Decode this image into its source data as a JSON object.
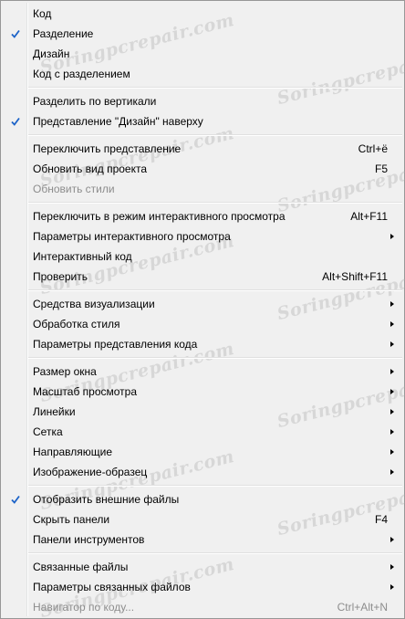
{
  "menu": {
    "watermark": "Soringpcrepair.com",
    "items": [
      {
        "label": "Код",
        "checked": false,
        "shortcut": "",
        "submenu": false,
        "disabled": false
      },
      {
        "label": "Разделение",
        "checked": true,
        "shortcut": "",
        "submenu": false,
        "disabled": false
      },
      {
        "label": "Дизайн",
        "checked": false,
        "shortcut": "",
        "submenu": false,
        "disabled": false
      },
      {
        "label": "Код с разделением",
        "checked": false,
        "shortcut": "",
        "submenu": false,
        "disabled": false
      },
      {
        "label": "Разделить по вертикали",
        "checked": false,
        "shortcut": "",
        "submenu": false,
        "disabled": false
      },
      {
        "label": "Представление \"Дизайн\" наверху",
        "checked": true,
        "shortcut": "",
        "submenu": false,
        "disabled": false
      },
      {
        "label": "Переключить представление",
        "checked": false,
        "shortcut": "Ctrl+ё",
        "submenu": false,
        "disabled": false
      },
      {
        "label": "Обновить вид проекта",
        "checked": false,
        "shortcut": "F5",
        "submenu": false,
        "disabled": false
      },
      {
        "label": "Обновить стили",
        "checked": false,
        "shortcut": "",
        "submenu": false,
        "disabled": true
      },
      {
        "label": "Переключить в режим интерактивного просмотра",
        "checked": false,
        "shortcut": "Alt+F11",
        "submenu": false,
        "disabled": false
      },
      {
        "label": "Параметры интерактивного просмотра",
        "checked": false,
        "shortcut": "",
        "submenu": true,
        "disabled": false
      },
      {
        "label": "Интерактивный код",
        "checked": false,
        "shortcut": "",
        "submenu": false,
        "disabled": false
      },
      {
        "label": "Проверить",
        "checked": false,
        "shortcut": "Alt+Shift+F11",
        "submenu": false,
        "disabled": false
      },
      {
        "label": "Средства визуализации",
        "checked": false,
        "shortcut": "",
        "submenu": true,
        "disabled": false
      },
      {
        "label": "Обработка стиля",
        "checked": false,
        "shortcut": "",
        "submenu": true,
        "disabled": false
      },
      {
        "label": "Параметры представления кода",
        "checked": false,
        "shortcut": "",
        "submenu": true,
        "disabled": false
      },
      {
        "label": "Размер окна",
        "checked": false,
        "shortcut": "",
        "submenu": true,
        "disabled": false
      },
      {
        "label": "Масштаб просмотра",
        "checked": false,
        "shortcut": "",
        "submenu": true,
        "disabled": false
      },
      {
        "label": "Линейки",
        "checked": false,
        "shortcut": "",
        "submenu": true,
        "disabled": false
      },
      {
        "label": "Сетка",
        "checked": false,
        "shortcut": "",
        "submenu": true,
        "disabled": false
      },
      {
        "label": "Направляющие",
        "checked": false,
        "shortcut": "",
        "submenu": true,
        "disabled": false
      },
      {
        "label": "Изображение-образец",
        "checked": false,
        "shortcut": "",
        "submenu": true,
        "disabled": false
      },
      {
        "label": "Отобразить внешние файлы",
        "checked": true,
        "shortcut": "",
        "submenu": false,
        "disabled": false
      },
      {
        "label": "Скрыть панели",
        "checked": false,
        "shortcut": "F4",
        "submenu": false,
        "disabled": false
      },
      {
        "label": "Панели инструментов",
        "checked": false,
        "shortcut": "",
        "submenu": true,
        "disabled": false
      },
      {
        "label": "Связанные файлы",
        "checked": false,
        "shortcut": "",
        "submenu": true,
        "disabled": false
      },
      {
        "label": "Параметры связанных файлов",
        "checked": false,
        "shortcut": "",
        "submenu": true,
        "disabled": false
      },
      {
        "label": "Навигатор по коду...",
        "checked": false,
        "shortcut": "Ctrl+Alt+N",
        "submenu": false,
        "disabled": true
      }
    ]
  }
}
